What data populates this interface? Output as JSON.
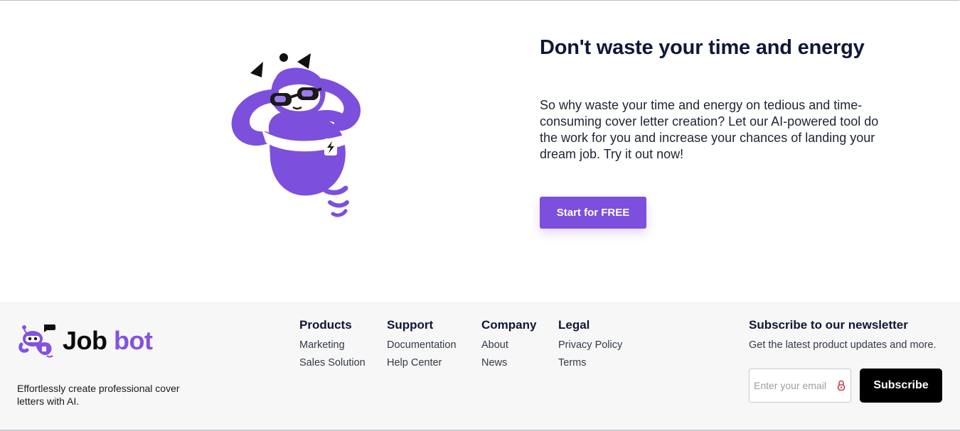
{
  "hero": {
    "title": "Don't waste your time and energy",
    "body": "So why waste your time and energy on tedious and time-consuming cover letter creation? Let our AI-powered tool do the work for you and increase your chances of landing your dream job. Try it out now!",
    "cta_label": "Start for FREE",
    "illustration": "relaxed-robot-mascot"
  },
  "footer": {
    "brand": {
      "name_part1": "Job",
      "name_part2": "bot",
      "logo_icon": "robot-logo"
    },
    "tagline": "Effortlessly create professional cover letters with AI.",
    "columns": [
      {
        "title": "Products",
        "links": [
          "Marketing",
          "Sales Solution"
        ]
      },
      {
        "title": "Support",
        "links": [
          "Documentation",
          "Help Center"
        ]
      },
      {
        "title": "Company",
        "links": [
          "About",
          "News"
        ]
      },
      {
        "title": "Legal",
        "links": [
          "Privacy Policy",
          "Terms"
        ]
      }
    ],
    "newsletter": {
      "title": "Subscribe to our newsletter",
      "description": "Get the latest product updates and more.",
      "email_placeholder": "Enter your email",
      "email_value": "",
      "subscribe_label": "Subscribe"
    }
  },
  "colors": {
    "brand_purple": "#7c4fdc",
    "heading_navy": "#0f1838",
    "footer_bg": "#f7f7f8",
    "subscribe_black": "#000000"
  }
}
